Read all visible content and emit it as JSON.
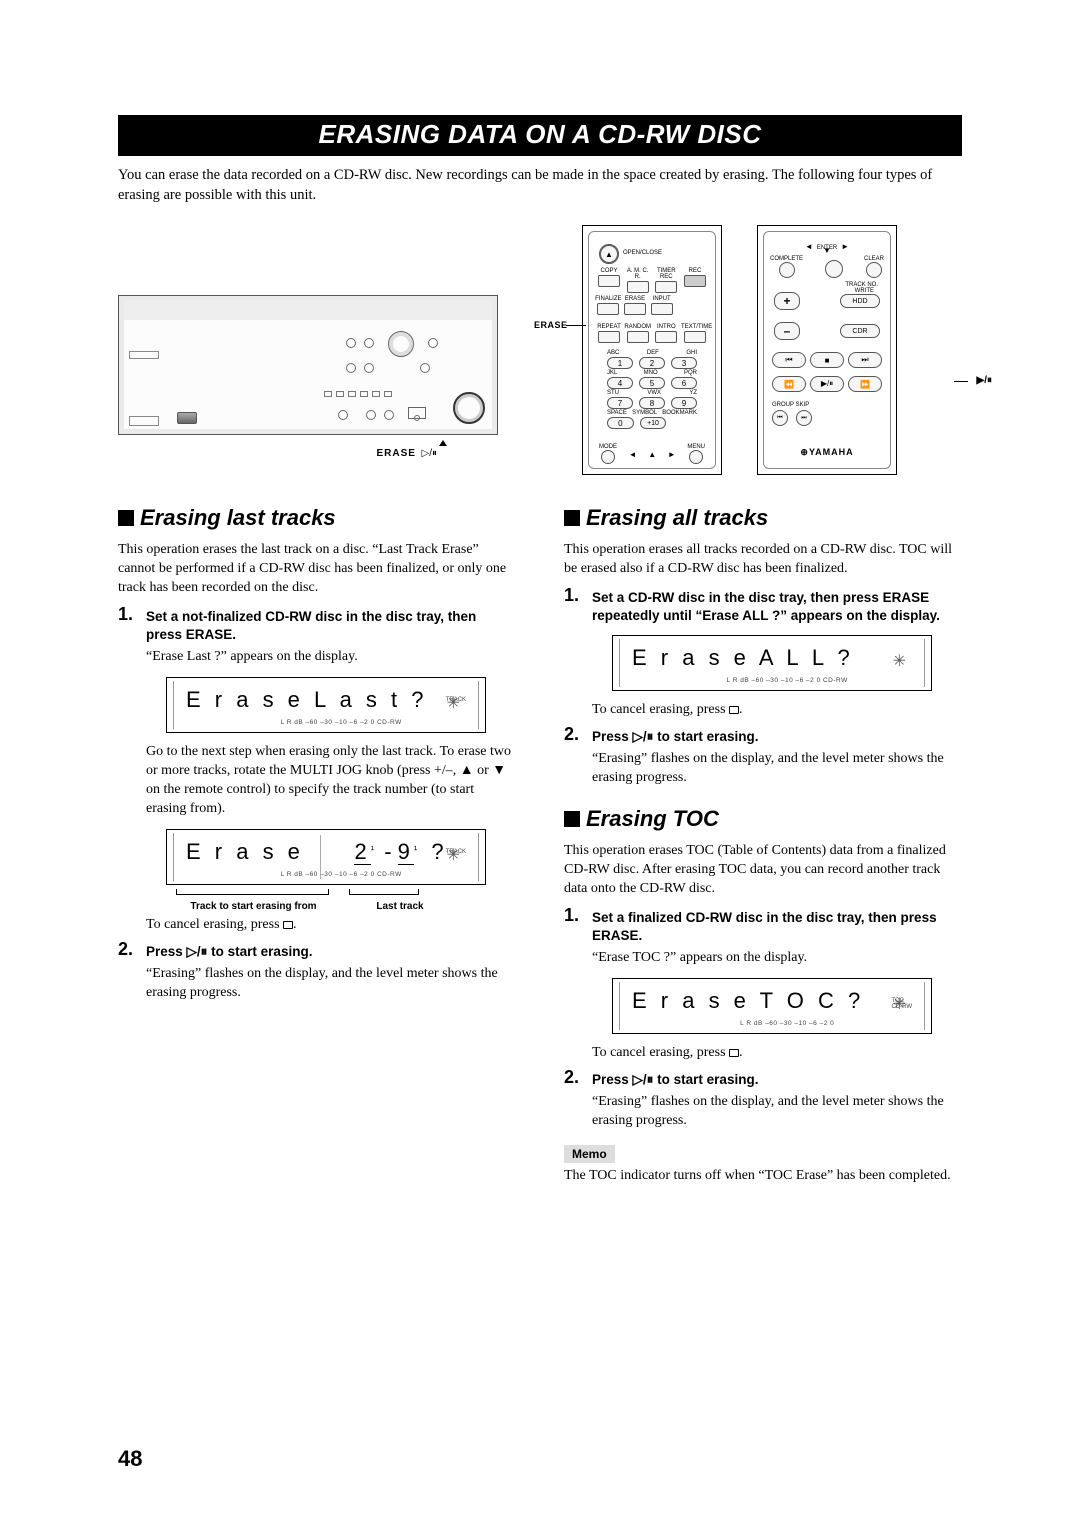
{
  "title": "ERASING DATA ON A CD-RW DISC",
  "intro": "You can erase the data recorded on a CD-RW disc. New recordings can be made in the space created by erasing. The following four types of erasing are possible with this unit.",
  "deck": {
    "label_erase": "ERASE",
    "label_playpause_glyphs": "▷/⏸"
  },
  "remote": {
    "label_erase": "ERASE",
    "label_playpause": "▶/⏸",
    "brand": "YAMAHA",
    "open_close": "OPEN/CLOSE",
    "row1": [
      "COPY",
      "A. M. C. R.",
      "TIMER REC",
      "REC"
    ],
    "row2": [
      "FINALIZE",
      "ERASE",
      "INPUT"
    ],
    "row3": [
      "REPEAT",
      "RANDOM",
      "INTRO",
      "TEXT/TIME"
    ],
    "letters": [
      "ABC",
      "DEF",
      "GHI",
      "JKL",
      "MNO",
      "PQR",
      "STU",
      "VWX",
      "YZ"
    ],
    "nums": [
      "1",
      "2",
      "3",
      "4",
      "5",
      "6",
      "7",
      "8",
      "9",
      "0",
      "+10"
    ],
    "bottom": [
      "SPACE",
      "SYMBOL",
      "BOOKMARK",
      "MODE",
      "MENU"
    ],
    "right_top": [
      "ENTER",
      "COMPLETE",
      "CLEAR",
      "TRACK NO.",
      "WRITE"
    ],
    "plus": "+",
    "minus": "–",
    "hdd": "HDD",
    "cdr": "CDR",
    "group_skip": "GROUP SKIP"
  },
  "left": {
    "h_last": "Erasing last tracks",
    "p_last": "This operation erases the last track on a disc. “Last Track Erase” cannot be performed if a CD-RW disc has been finalized, or only one track has been recorded on the disc.",
    "s1_head": "Set a not-finalized CD-RW disc in the disc tray, then press ERASE.",
    "s1_body": "“Erase Last ?” appears on the display.",
    "disp1": "E r a s e   L a s t    ?",
    "disp1_sub": "L  R   dB  –60  –30   –10    –6     –2     0        CD-RW",
    "disp1_tag": "TRACK",
    "go_next": "Go to the next step when erasing only the last track. To erase two or more tracks, rotate the MULTI JOG knob (press +/–, ▲ or ▼ on the remote control) to specify the track number (to start erasing from).",
    "disp2a": "E r a s e",
    "disp2b": "2",
    "disp2c": "9",
    "disp2q": "?",
    "disp2_sub": "L  R   dB  –60  –30   –10    –6     –2     0        CD-RW",
    "cap_a": "Track to start erasing from",
    "cap_b": "Last track",
    "cancel": "To cancel erasing, press ",
    "s2_head": "Press ▷/⏸ to start erasing.",
    "s2_body": "“Erasing” flashes on the display, and the level meter shows the erasing progress."
  },
  "right": {
    "h_all": "Erasing all tracks",
    "p_all": "This operation erases all tracks recorded on a CD-RW disc. TOC will be erased also if a CD-RW disc has been finalized.",
    "s1_head": "Set a CD-RW disc in the disc tray, then press ERASE repeatedly until “Erase ALL ?” appears on the display.",
    "disp_all": "E r a s e   A L L    ?",
    "disp_all_sub": "L  R   dB  –60  –30   –10    –6     –2     0        CD-RW",
    "cancel": "To cancel erasing, press ",
    "s2_head": "Press ▷/⏸ to start erasing.",
    "s2_body": "“Erasing” flashes on the display, and the level meter shows the erasing progress.",
    "h_toc": "Erasing TOC",
    "p_toc": "This operation erases TOC (Table of Contents) data from a finalized CD-RW disc. After erasing TOC data, you can record another track data onto the CD-RW disc.",
    "toc_s1_head": "Set a finalized CD-RW disc in the disc tray, then press ERASE.",
    "toc_s1_body": "“Erase TOC ?” appears on the display.",
    "disp_toc": "E r a s e   T O C    ?",
    "disp_toc_sub": "L  R   dB  –60  –30   –10    –6     –2     0",
    "disp_toc_tag": "TOC\nCD-RW",
    "toc_s2_head": "Press ▷/⏸ to start erasing.",
    "toc_s2_body": "“Erasing” flashes on the display, and the level meter shows the erasing progress.",
    "memo_label": "Memo",
    "memo_text": "The TOC indicator turns off when “TOC Erase” has been completed."
  },
  "page": "48"
}
